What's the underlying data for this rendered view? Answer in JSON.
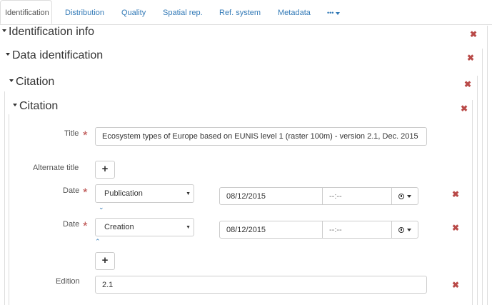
{
  "tabs": [
    {
      "label": "Identification"
    },
    {
      "label": "Distribution"
    },
    {
      "label": "Quality"
    },
    {
      "label": "Spatial rep."
    },
    {
      "label": "Ref. system"
    },
    {
      "label": "Metadata"
    },
    {
      "label": "•••"
    }
  ],
  "sections": {
    "identification_info": "Identification info",
    "data_identification": "Data identification",
    "citation_outer": "Citation",
    "citation_inner": "Citation"
  },
  "remove_glyph": "✖",
  "required_mark": "*",
  "add_glyph": "+",
  "fields": {
    "title": {
      "label": "Title",
      "value": "Ecosystem types of Europe based on EUNIS level 1 (raster 100m) - version 2.1, Dec. 2015"
    },
    "alternate_title": {
      "label": "Alternate title"
    },
    "dates": [
      {
        "label": "Date",
        "type": "Publication",
        "date": "08/12/2015",
        "time": "--:--",
        "chevron": "⌵"
      },
      {
        "label": "Date",
        "type": "Creation",
        "date": "08/12/2015",
        "time": "--:--",
        "chevron": "^"
      }
    ],
    "edition": {
      "label": "Edition",
      "value": "2.1"
    }
  }
}
